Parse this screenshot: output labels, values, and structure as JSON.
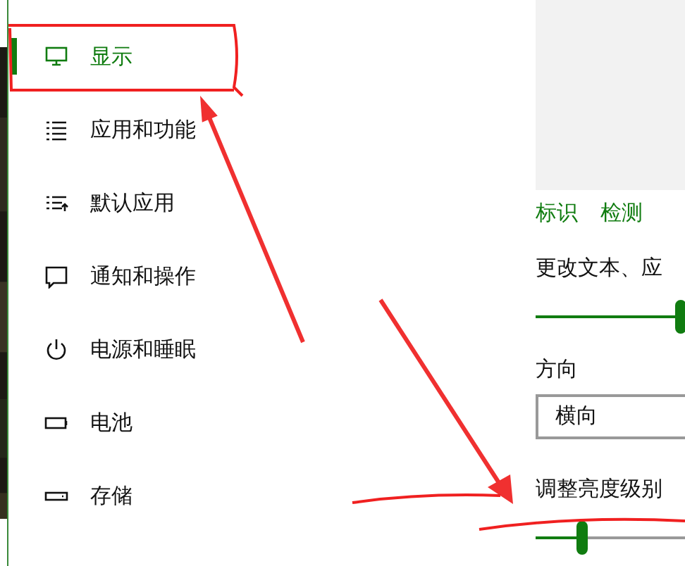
{
  "nav": [
    {
      "label": "显示",
      "selected": true
    },
    {
      "label": "应用和功能",
      "selected": false
    },
    {
      "label": "默认应用",
      "selected": false
    },
    {
      "label": "通知和操作",
      "selected": false
    },
    {
      "label": "电源和睡眠",
      "selected": false
    },
    {
      "label": "电池",
      "selected": false
    },
    {
      "label": "存储",
      "selected": false
    }
  ],
  "display": {
    "links": [
      "标识",
      "检测"
    ],
    "scale": {
      "label": "更改文本、应",
      "level": 0.97
    },
    "orientation": {
      "label": "方向",
      "value": "横向"
    },
    "brightness": {
      "label": "调整亮度级别",
      "level": 0.31
    }
  }
}
